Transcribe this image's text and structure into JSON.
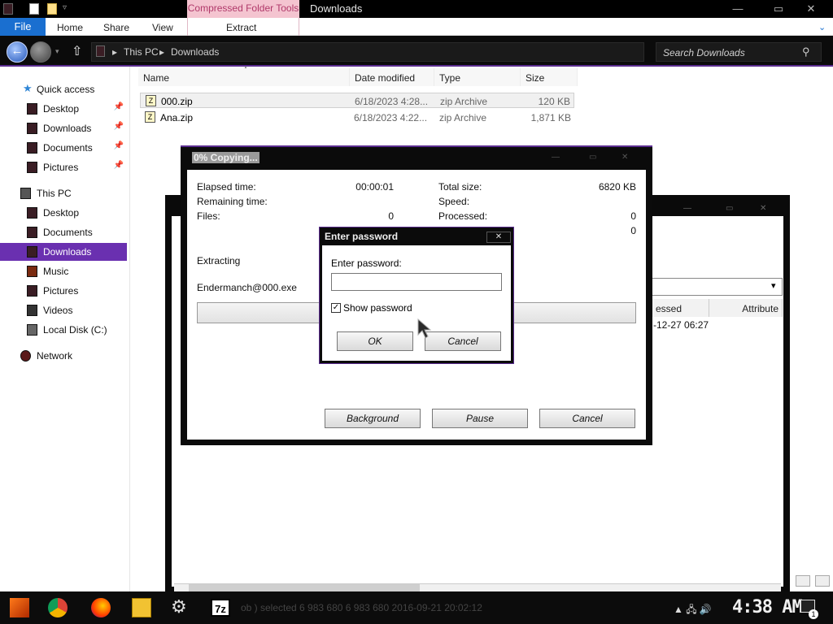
{
  "titlebar": {
    "context_tab": "Compressed Folder Tools",
    "title": "Downloads",
    "minimize": "—",
    "maximize": "▭",
    "close": "✕"
  },
  "ribbon": {
    "file": "File",
    "home": "Home",
    "share": "Share",
    "view": "View",
    "extract": "Extract"
  },
  "address": {
    "crumbs": [
      "This PC",
      "Downloads"
    ],
    "separator": "▸",
    "search_placeholder": "Search Downloads"
  },
  "nav": {
    "quick_access": "Quick access",
    "quick_items": [
      "Desktop",
      "Downloads",
      "Documents",
      "Pictures"
    ],
    "this_pc": "This PC",
    "pc_items": [
      "Desktop",
      "Documents",
      "Downloads",
      "Music",
      "Pictures",
      "Videos",
      "Local Disk (C:)"
    ],
    "network": "Network"
  },
  "filelist": {
    "columns": [
      "Name",
      "Date modified",
      "Type",
      "Size"
    ],
    "rows": [
      {
        "name": "000.zip",
        "date": "6/18/2023 4:28...",
        "type": "zip Archive",
        "size": "120 KB"
      },
      {
        "name": "Ana.zip",
        "date": "6/18/2023 4:22...",
        "type": "zip Archive",
        "size": "1,871 KB"
      }
    ]
  },
  "bg_window": {
    "col_accessed": "essed",
    "col_attributes": "Attribute",
    "accessed_value": "-12-27 06:27",
    "dropdown_arrow": "▾"
  },
  "copy_dialog": {
    "title": "0% Copying...",
    "elapsed_label": "Elapsed time:",
    "elapsed_value": "00:00:01",
    "remaining_label": "Remaining time:",
    "files_label": "Files:",
    "files_value": "0",
    "total_label": "Total size:",
    "total_value": "6820 KB",
    "speed_label": "Speed:",
    "processed_label": "Processed:",
    "processed_value": "0",
    "extra_value": "0",
    "status": "Extracting",
    "current_file": "Endermanch@000.exe",
    "progress": 0,
    "btn_background": "Background",
    "btn_pause": "Pause",
    "btn_cancel": "Cancel"
  },
  "password_dialog": {
    "title": "Enter password",
    "close": "✕",
    "label": "Enter password:",
    "value": "",
    "show_password": "Show password",
    "show_checked": "✓",
    "ok": "OK",
    "cancel": "Cancel"
  },
  "taskbar": {
    "status_text": "ob   ) selected         6 983 680        6 983 680        2016-09-21 20:02:12",
    "clock": "4:38 AM",
    "tray": "▲  🖧  🔊",
    "notif_count": "1",
    "gear": "⚙",
    "sevenzip": "7z"
  },
  "colors": {
    "accent": "#6a30b0",
    "file_tab": "#1a6fd0",
    "context_tab": "#f4c4d0"
  }
}
